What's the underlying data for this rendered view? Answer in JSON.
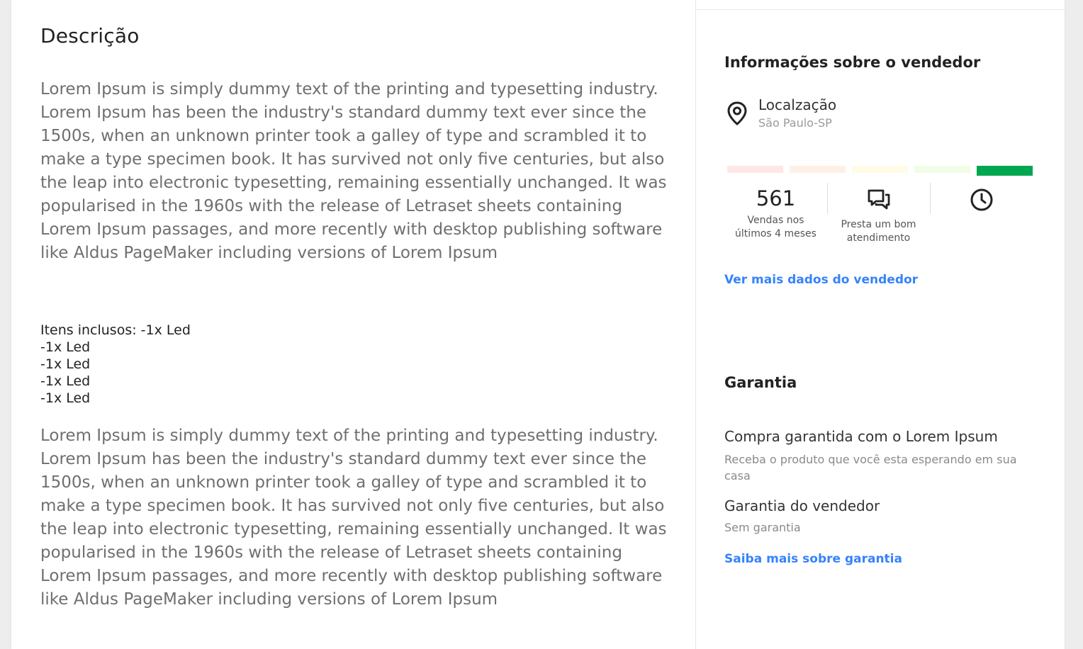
{
  "description": {
    "title": "Descrição",
    "paragraph_1": "Lorem Ipsum is simply dummy text of the printing and typesetting industry. Lorem Ipsum has been the industry's standard dummy text ever since the 1500s, when an unknown printer took a galley of type and scrambled it to make a type specimen book. It has survived not only five centuries, but also the leap into electronic typesetting, remaining essentially unchanged. It was popularised in the 1960s with the release of Letraset sheets containing Lorem Ipsum passages, and more recently with desktop publishing software like Aldus PageMaker including versions of Lorem Ipsum",
    "included_items": [
      "Itens inclusos: -1x Led",
      "-1x Led",
      "-1x Led",
      "-1x Led",
      "-1x Led"
    ],
    "paragraph_2": "Lorem Ipsum is simply dummy text of the printing and typesetting industry. Lorem Ipsum has been the industry's standard dummy text ever since the 1500s, when an unknown printer took a galley of type and scrambled it to make a type specimen book. It has survived not only five centuries, but also the leap into electronic typesetting, remaining essentially unchanged. It was popularised in the 1960s with the release of Letraset sheets containing Lorem Ipsum passages, and more recently with desktop publishing software like Aldus PageMaker including versions of Lorem Ipsum"
  },
  "seller": {
    "title": "Informações sobre o vendedor",
    "location_label": "Localzação",
    "location_value": "São Paulo-SP",
    "location_icon": "location-pin-icon",
    "reputation": {
      "colors": [
        "#fee7e6",
        "#fff0e6",
        "#fffbe6",
        "#f1fde6",
        "#00a650"
      ],
      "active_level": 5
    },
    "sales_count": "561",
    "sales_label": "Vendas nos últimos 4 meses",
    "service_icon": "chat-bubbles-icon",
    "service_label": "Presta um bom atendimento",
    "delivery_icon": "clock-icon",
    "more_link": "Ver mais dados do vendedor"
  },
  "warranty": {
    "title": "Garantia",
    "item_1_title": "Compra garantida com o Lorem Ipsum",
    "item_1_sub": "Receba o produto que você esta esperando em sua casa",
    "item_2_title": "Garantia do vendedor",
    "item_2_sub": "Sem garantia",
    "more_link": "Saiba mais sobre garantia"
  },
  "colors": {
    "link": "#3483fa",
    "text_muted": "#6f6f6f"
  }
}
